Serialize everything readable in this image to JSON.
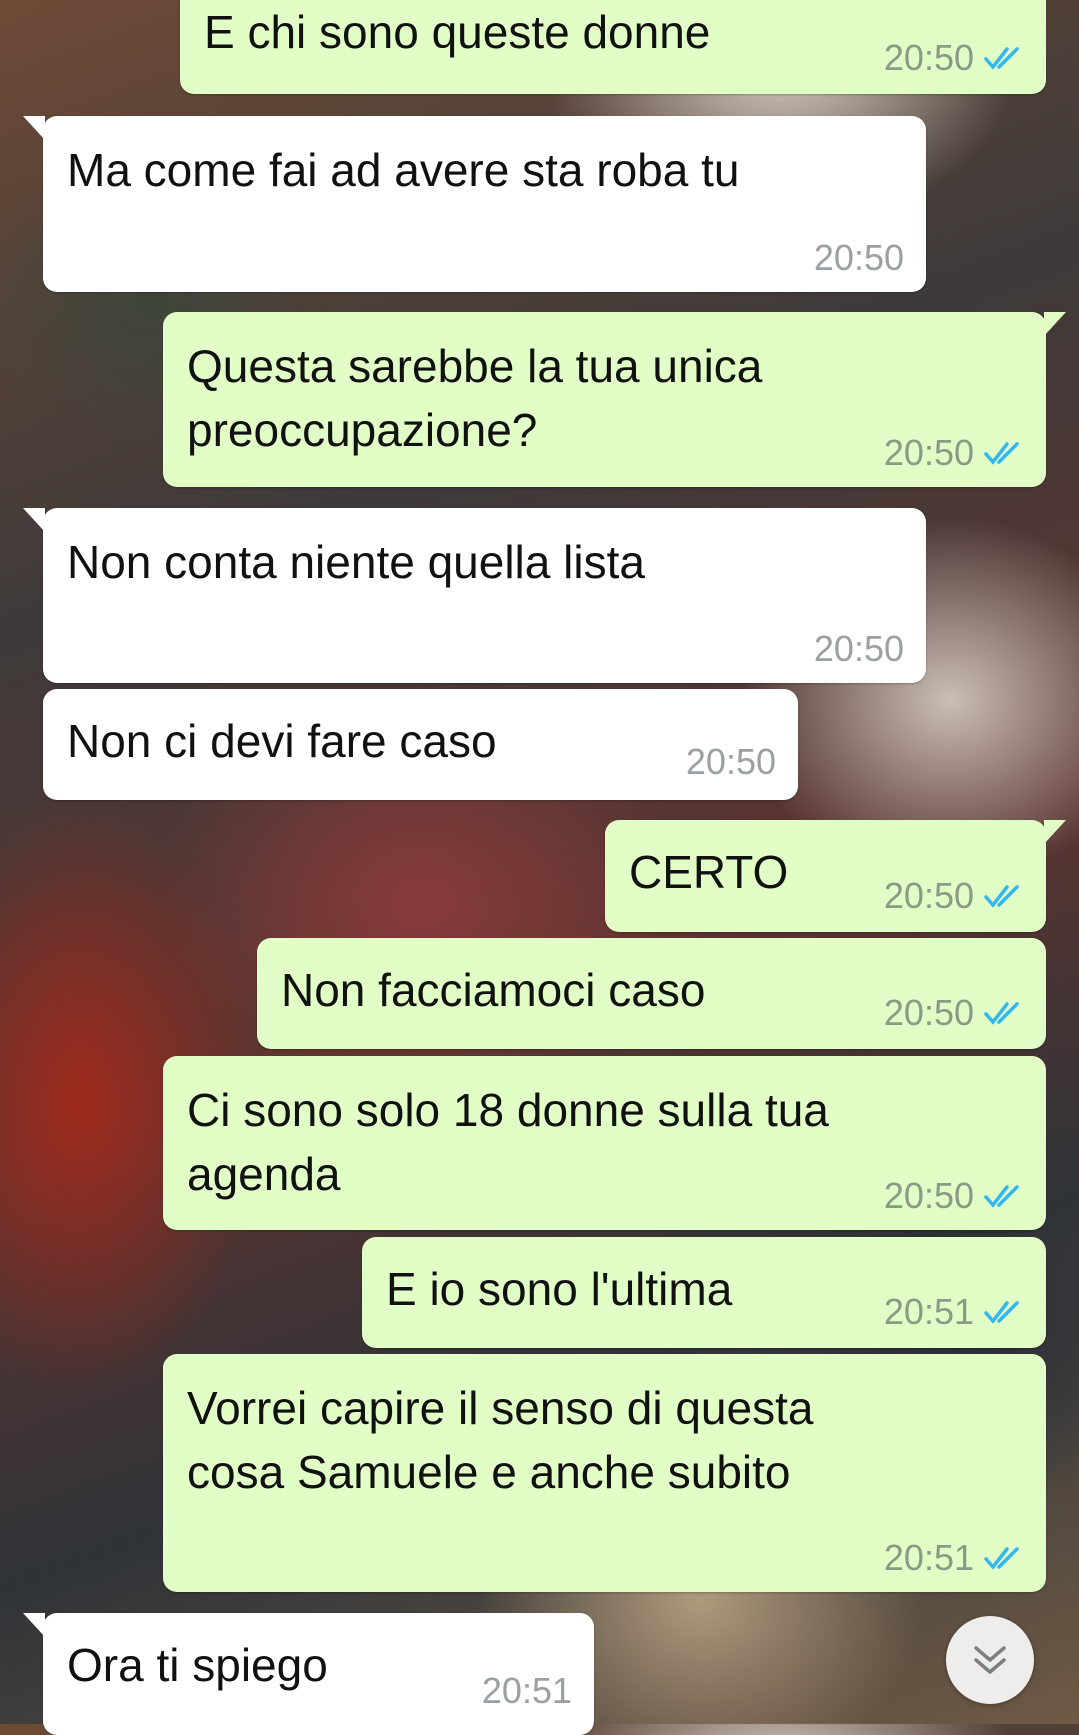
{
  "messages": [
    {
      "text": "E chi sono queste donne",
      "time": "20:50",
      "dir": "out",
      "status": "read"
    },
    {
      "text": "Ma come fai ad avere sta roba tu",
      "time": "20:50",
      "dir": "in"
    },
    {
      "text": "Questa sarebbe la tua unica\npreoccupazione?",
      "time": "20:50",
      "dir": "out",
      "status": "read"
    },
    {
      "text": "Non conta niente quella lista",
      "time": "20:50",
      "dir": "in"
    },
    {
      "text": "Non ci devi fare caso",
      "time": "20:50",
      "dir": "in"
    },
    {
      "text": "CERTO",
      "time": "20:50",
      "dir": "out",
      "status": "read"
    },
    {
      "text": "Non facciamoci caso",
      "time": "20:50",
      "dir": "out",
      "status": "read"
    },
    {
      "text": "Ci sono solo 18 donne sulla tua\nagenda",
      "time": "20:50",
      "dir": "out",
      "status": "read"
    },
    {
      "text": "E io sono l'ultima",
      "time": "20:51",
      "dir": "out",
      "status": "read"
    },
    {
      "text": "Vorrei capire il senso di questa\ncosa Samuele e anche subito",
      "time": "20:51",
      "dir": "out",
      "status": "read"
    },
    {
      "text": "Ora ti spiego",
      "time": "20:51",
      "dir": "in"
    }
  ],
  "scroll_button": {
    "icon": "double-chevron-down-icon"
  },
  "colors": {
    "outgoing_bubble": "#e1fec6",
    "incoming_bubble": "#ffffff",
    "read_tick": "#34b7f1"
  }
}
